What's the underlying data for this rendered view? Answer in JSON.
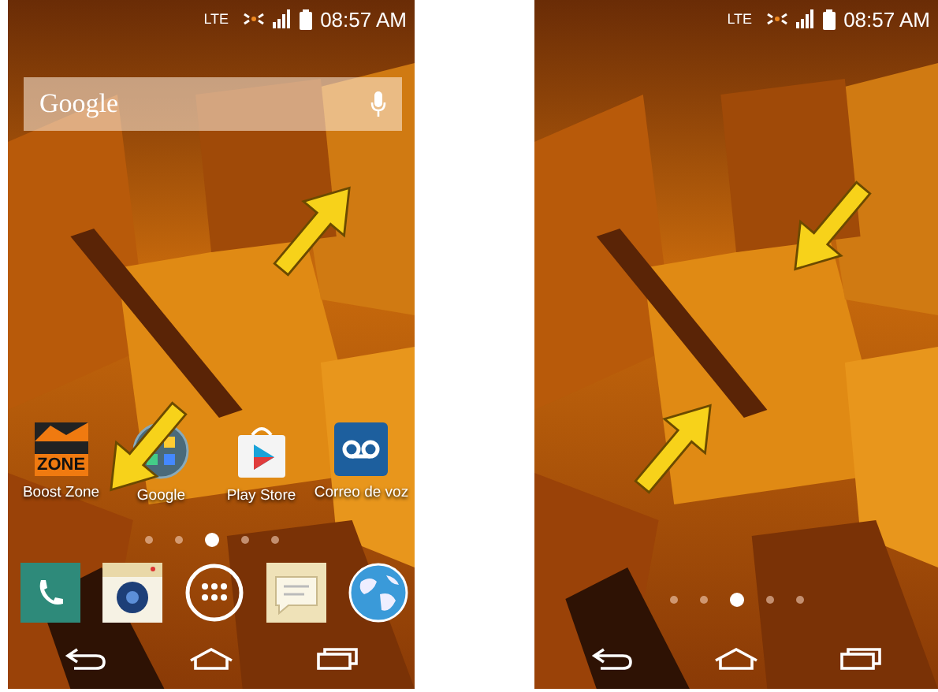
{
  "screens": [
    {
      "status_bar": {
        "network": "LTE",
        "time": "08:57 AM"
      },
      "search_bar": {
        "label": "Google"
      },
      "apps": [
        {
          "kind": "boost",
          "label": "Boost Zone",
          "icon_text": "ZONE"
        },
        {
          "kind": "folder",
          "label": "Google"
        },
        {
          "kind": "store",
          "label": "Play Store"
        },
        {
          "kind": "voicemail",
          "label": "Correo de voz"
        }
      ],
      "page_dots": [
        {
          "selected": false
        },
        {
          "selected": false
        },
        {
          "selected": true
        },
        {
          "selected": false
        },
        {
          "selected": false
        }
      ],
      "dock": [
        {
          "kind": "phone"
        },
        {
          "kind": "camera"
        },
        {
          "kind": "apps"
        },
        {
          "kind": "messages"
        },
        {
          "kind": "browser"
        }
      ],
      "arrows": [
        {
          "kind": "northeast"
        },
        {
          "kind": "southwest"
        }
      ]
    },
    {
      "status_bar": {
        "network": "LTE",
        "time": "08:57 AM"
      },
      "page_dots": [
        {
          "selected": false
        },
        {
          "selected": false
        },
        {
          "selected": true
        },
        {
          "selected": false
        },
        {
          "selected": false
        }
      ],
      "arrows": [
        {
          "kind": "southwest"
        },
        {
          "kind": "northeast"
        }
      ]
    }
  ]
}
